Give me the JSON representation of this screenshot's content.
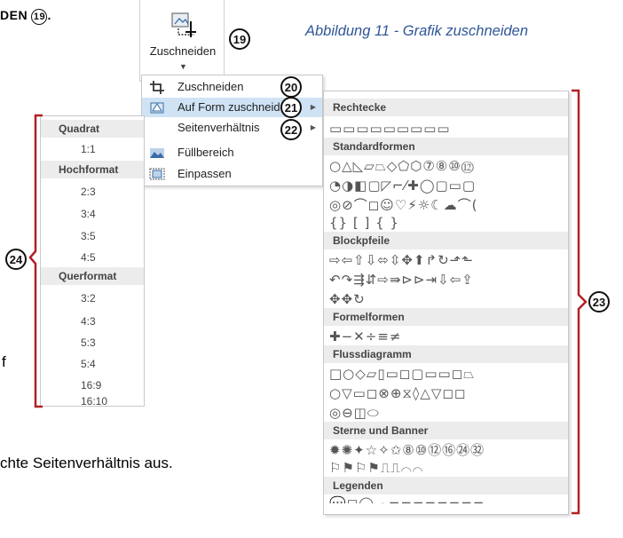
{
  "document": {
    "top_text": "DEN",
    "caption": "Abbildung 11 - Grafik zuschneiden",
    "partial_left": "f",
    "bottom_text": "chte Seitenverhältnis aus."
  },
  "markers": {
    "m19": "19",
    "m20": "20",
    "m21": "21",
    "m22": "22",
    "m23": "23",
    "m24": "24"
  },
  "crop_button": {
    "label": "Zuschneiden",
    "icon": "crop-icon",
    "dropdown_icon": "chevron-down-icon"
  },
  "crop_menu": {
    "items": [
      {
        "label": "Zuschneiden",
        "icon": "crop-icon"
      },
      {
        "label": "Auf Form zuschneiden",
        "icon": "shape-crop-icon",
        "submenu": true
      },
      {
        "label": "Seitenverhältnis",
        "submenu": true
      },
      {
        "label": "Füllbereich",
        "icon": "fill-icon"
      },
      {
        "label": "Einpassen",
        "icon": "fit-icon"
      }
    ]
  },
  "aspect_menu": {
    "groups": [
      {
        "title": "Quadrat",
        "items": [
          "1:1"
        ]
      },
      {
        "title": "Hochformat",
        "items": [
          "2:3",
          "3:4",
          "3:5",
          "4:5"
        ]
      },
      {
        "title": "Querformat",
        "items": [
          "3:2",
          "4:3",
          "5:3",
          "5:4",
          "16:9",
          "16:10"
        ]
      }
    ]
  },
  "shapes_panel": {
    "sections": [
      {
        "title": "Rechtecke",
        "rows": [
          "▭▭▭▭▭▭▭▭▭"
        ]
      },
      {
        "title": "Standardformen",
        "rows": [
          "○△◺▱⏢◇⬠⬡⑦⑧⑩⑫",
          "◔◑◧▢◸⌐⁄✚◯▢▭▢",
          "◎⊘⌒◻☺♡⚡☼☾☁⌒(",
          "{} [ ] { }"
        ]
      },
      {
        "title": "Blockpfeile",
        "rows": [
          "⇨⇦⇧⇩⬄⇳✥⬆↱↻⬏⬑",
          "↶↷⇶⇵⇨⇛⊳⊳⇥⇩⇦⇪",
          "✥✥↻"
        ]
      },
      {
        "title": "Formelformen",
        "rows": [
          "✚−✕÷≡≠"
        ]
      },
      {
        "title": "Flussdiagramm",
        "rows": [
          "□○◇▱▯▭◻▢▭▭◻⏢",
          "○▽▭◻⊗⊕⧖◊△▽◻◻",
          "◎⊖◫⬭"
        ]
      },
      {
        "title": "Sterne und Banner",
        "rows": [
          "✹✺✦☆✧✩⑧⑩⑫⑯㉔㉜",
          "⚐⚑⚐⚑⎍⎍⌒⌒"
        ]
      },
      {
        "title": "Legenden",
        "rows": [
          "💬◻◯☁⌐⌐⌐⌐⌐⌐⌐⌐",
          "⌐⌐⌐⌐"
        ]
      }
    ]
  }
}
